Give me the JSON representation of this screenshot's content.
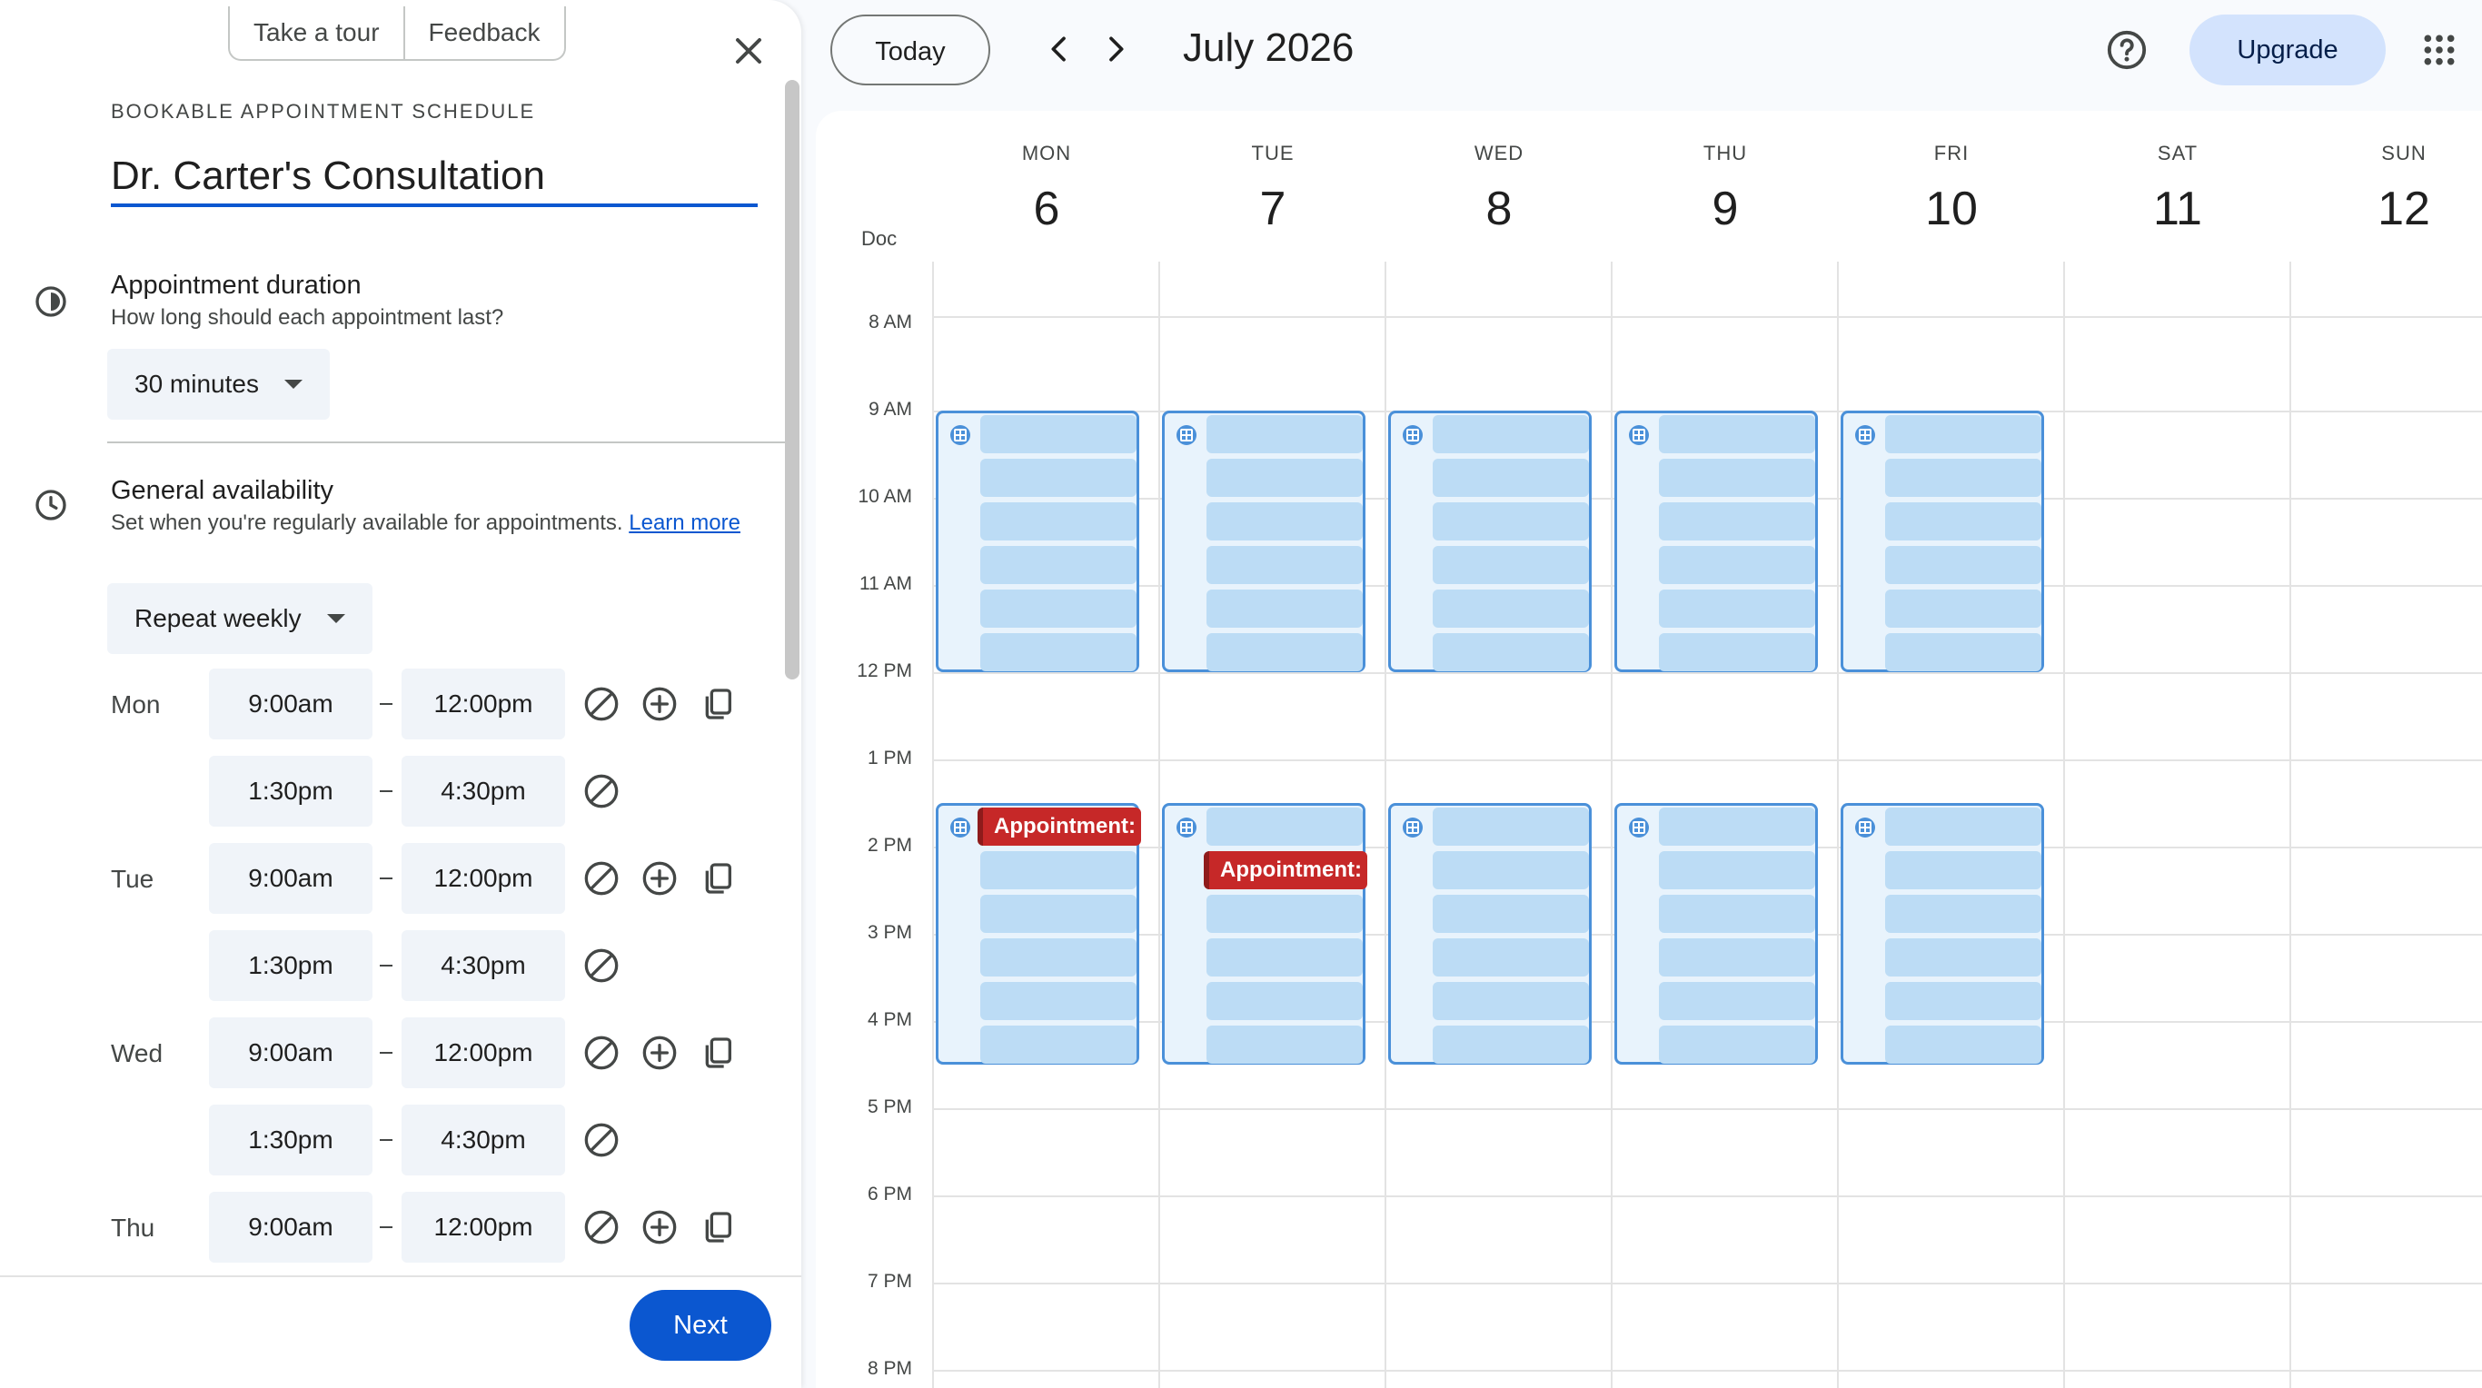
{
  "panel": {
    "tour_label": "Take a tour",
    "feedback_label": "Feedback",
    "schedule_kind": "BOOKABLE APPOINTMENT SCHEDULE",
    "title": "Dr. Carter's Consultation",
    "duration": {
      "title": "Appointment duration",
      "subtitle": "How long should each appointment last?",
      "value": "30 minutes"
    },
    "availability": {
      "title": "General availability",
      "subtitle": "Set when you're regularly available for appointments.",
      "learn_more": "Learn more",
      "repeat": "Repeat weekly",
      "dash": "–",
      "days": [
        {
          "label": "Mon",
          "ranges": [
            {
              "start": "9:00am",
              "end": "12:00pm"
            },
            {
              "start": "1:30pm",
              "end": "4:30pm"
            }
          ]
        },
        {
          "label": "Tue",
          "ranges": [
            {
              "start": "9:00am",
              "end": "12:00pm"
            },
            {
              "start": "1:30pm",
              "end": "4:30pm"
            }
          ]
        },
        {
          "label": "Wed",
          "ranges": [
            {
              "start": "9:00am",
              "end": "12:00pm"
            },
            {
              "start": "1:30pm",
              "end": "4:30pm"
            }
          ]
        },
        {
          "label": "Thu",
          "ranges": [
            {
              "start": "9:00am",
              "end": "12:00pm"
            }
          ]
        }
      ]
    },
    "next_label": "Next"
  },
  "topbar": {
    "today_label": "Today",
    "month_title": "July 2026",
    "upgrade_label": "Upgrade"
  },
  "calendar": {
    "timezone_label": "Doc",
    "days": [
      {
        "dow": "MON",
        "num": "6"
      },
      {
        "dow": "TUE",
        "num": "7"
      },
      {
        "dow": "WED",
        "num": "8"
      },
      {
        "dow": "THU",
        "num": "9"
      },
      {
        "dow": "FRI",
        "num": "10"
      },
      {
        "dow": "SAT",
        "num": "11"
      },
      {
        "dow": "SUN",
        "num": "12"
      }
    ],
    "hours": [
      "8 AM",
      "9 AM",
      "10 AM",
      "11 AM",
      "12 PM",
      "1 PM",
      "2 PM",
      "3 PM",
      "4 PM",
      "5 PM",
      "6 PM",
      "7 PM",
      "8 PM"
    ],
    "appointment_label": "Appointment:",
    "colors": {
      "block_border": "#4a90d9",
      "slot": "#bcdcf5",
      "appointment": "#c62828",
      "accent": "#0b57d0"
    }
  }
}
